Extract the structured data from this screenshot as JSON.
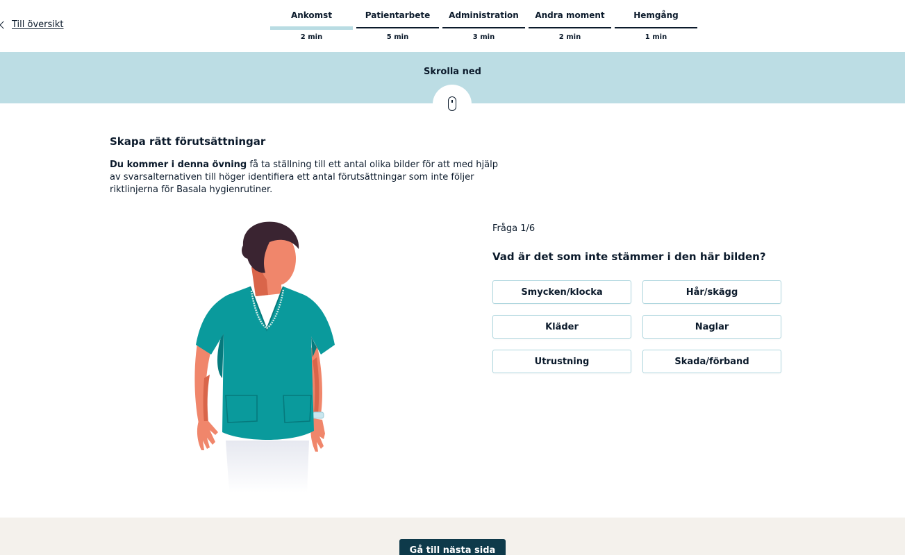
{
  "nav": {
    "back_label": "Till översikt",
    "steps": [
      {
        "name": "Ankomst",
        "time": "2 min",
        "active": true
      },
      {
        "name": "Patientarbete",
        "time": "5 min",
        "active": false
      },
      {
        "name": "Administration",
        "time": "3 min",
        "active": false
      },
      {
        "name": "Andra moment",
        "time": "2 min",
        "active": false
      },
      {
        "name": "Hemgång",
        "time": "1 min",
        "active": false
      }
    ]
  },
  "scroll": {
    "label": "Skrolla ned",
    "icon": "mouse-icon"
  },
  "intro": {
    "title": "Skapa rätt förutsättningar",
    "lead": "Du kommer i denna övning",
    "body": " få ta ställning till ett antal olika bilder för att med hjälp av svarsalternativen till höger identifiera ett antal förutsättningar som inte följer riktlinjerna för Basala hygienrutiner."
  },
  "quiz": {
    "counter": "Fråga 1/6",
    "question": "Vad är det som inte stämmer i den här bilden?",
    "answers": [
      "Smycken/klocka",
      "Hår/skägg",
      "Kläder",
      "Naglar",
      "Utrustning",
      "Skada/förband"
    ]
  },
  "footer": {
    "next_label": "Gå till nästa sida"
  },
  "colors": {
    "accent_band": "#bcdde4",
    "scrubs": "#0a9a9c",
    "dark_button": "#0e3a4a",
    "footer_bg": "#f4f1ec"
  }
}
